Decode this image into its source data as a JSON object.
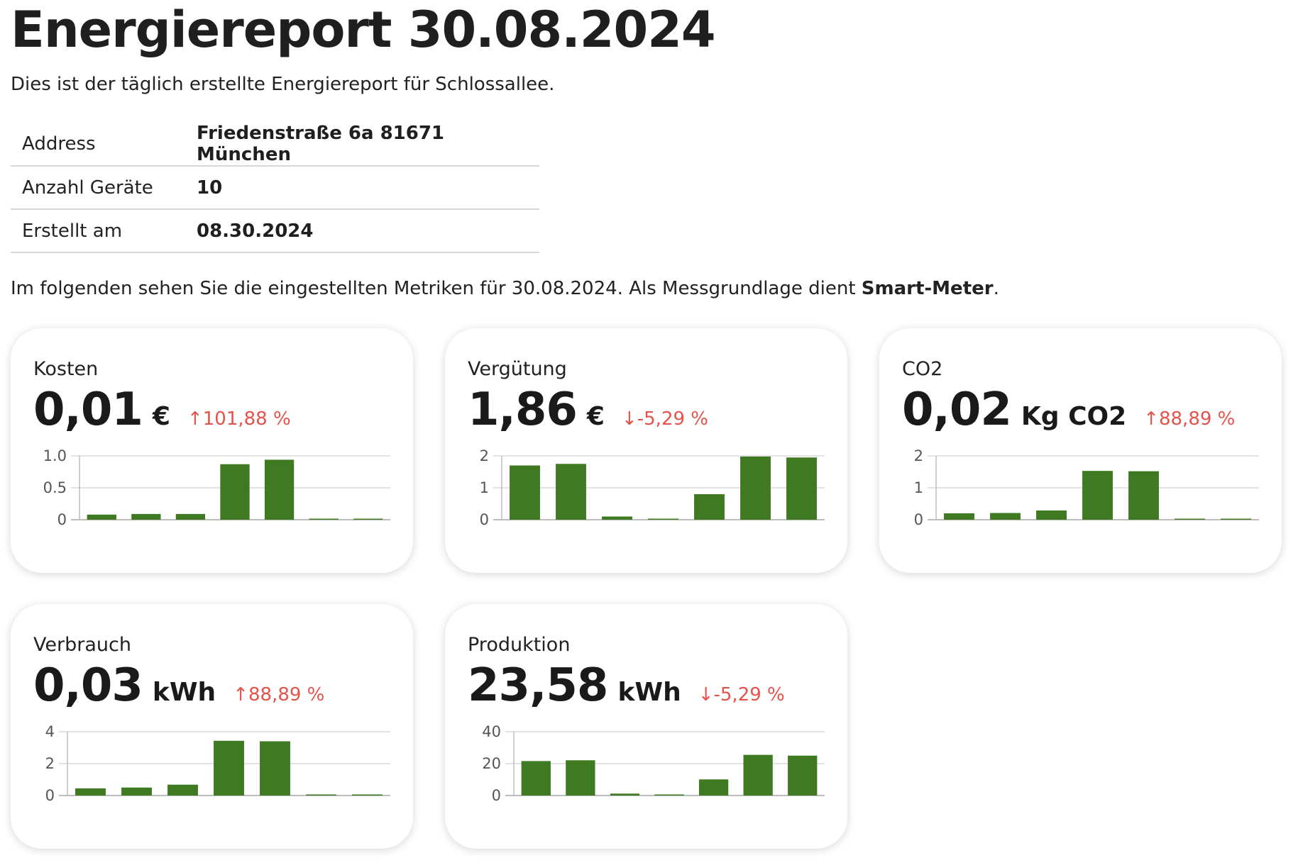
{
  "header": {
    "title": "Energiereport 30.08.2024",
    "intro": "Dies ist der täglich erstellte Energiereport für Schlossallee."
  },
  "info": [
    {
      "key": "Address",
      "value": "Friedenstraße 6a 81671 München"
    },
    {
      "key": "Anzahl Geräte",
      "value": "10"
    },
    {
      "key": "Erstellt am",
      "value": "08.30.2024"
    }
  ],
  "metrics_intro": {
    "prefix": "Im folgenden sehen Sie die eingestellten Metriken für 30.08.2024. Als Messgrundlage dient ",
    "basis": "Smart-Meter",
    "suffix": "."
  },
  "colors": {
    "bar": "#3f7a22",
    "negative_change": "#e5534b",
    "grid": "#d9d9d9"
  },
  "cards": [
    {
      "title": "Kosten",
      "value": "0,01",
      "unit": "€",
      "change": "↑101,88 %"
    },
    {
      "title": "Vergütung",
      "value": "1,86",
      "unit": "€",
      "change": "↓-5,29 %"
    },
    {
      "title": "CO2",
      "value": "0,02",
      "unit": "Kg CO2",
      "change": "↑88,89 %"
    },
    {
      "title": "Verbrauch",
      "value": "0,03",
      "unit": "kWh",
      "change": "↑88,89 %"
    },
    {
      "title": "Produktion",
      "value": "23,58",
      "unit": "kWh",
      "change": "↓-5,29 %"
    }
  ],
  "chart_data": [
    {
      "type": "bar",
      "title": "",
      "values": [
        0.08,
        0.09,
        0.09,
        0.87,
        0.94,
        0.005,
        0.005
      ],
      "ylim": [
        0,
        1.0
      ],
      "yticks": [
        "0",
        "0.5",
        "1.0"
      ],
      "grid": true
    },
    {
      "type": "bar",
      "title": "",
      "values": [
        1.7,
        1.75,
        0.1,
        0.03,
        0.8,
        1.98,
        1.95
      ],
      "ylim": [
        0,
        2
      ],
      "yticks": [
        "0",
        "1",
        "2"
      ],
      "grid": true
    },
    {
      "type": "bar",
      "title": "",
      "values": [
        0.2,
        0.21,
        0.29,
        1.53,
        1.52,
        0.01,
        0.01
      ],
      "ylim": [
        0,
        2
      ],
      "yticks": [
        "0",
        "1",
        "2"
      ],
      "grid": true
    },
    {
      "type": "bar",
      "title": "",
      "values": [
        0.45,
        0.5,
        0.68,
        3.43,
        3.4,
        0.03,
        0.03
      ],
      "ylim": [
        0,
        4
      ],
      "yticks": [
        "0",
        "2",
        "4"
      ],
      "grid": true
    },
    {
      "type": "bar",
      "title": "",
      "values": [
        21.6,
        22.1,
        1.2,
        0.4,
        10.1,
        25.5,
        25.0
      ],
      "ylim": [
        0,
        40
      ],
      "yticks": [
        "0",
        "20",
        "40"
      ],
      "grid": true
    }
  ]
}
